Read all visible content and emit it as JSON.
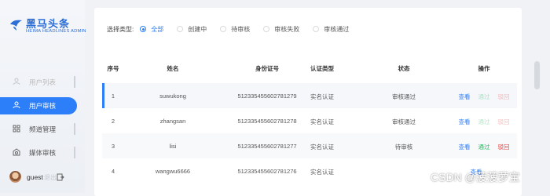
{
  "brand": {
    "name": "黑马头条",
    "sub": "HEIMA HEADLINES ADMIN"
  },
  "nav": [
    {
      "label": "用户列表",
      "icon": "user-list-icon",
      "state": "faded"
    },
    {
      "label": "用户审核",
      "icon": "user-audit-icon",
      "state": "active"
    },
    {
      "label": "频道管理",
      "icon": "channel-icon",
      "state": "normal"
    },
    {
      "label": "媒体审核",
      "icon": "media-icon",
      "state": "normal"
    }
  ],
  "user": {
    "name": "guest",
    "extra": "退出"
  },
  "filter": {
    "label": "选择类型:",
    "options": [
      "全部",
      "创建中",
      "待审核",
      "审核失败",
      "审核通过"
    ],
    "selected": "全部"
  },
  "table": {
    "headers": {
      "id": "序号",
      "name": "姓名",
      "idno": "身份证号",
      "type": "认证类型",
      "status": "状态",
      "ops": "操作"
    },
    "rows": [
      {
        "id": "1",
        "name": "suwukong",
        "idno": "512335455602781279",
        "type": "实名认证",
        "status": "审核通过",
        "view": "查看",
        "pass": "通过",
        "reject": "驳回"
      },
      {
        "id": "2",
        "name": "zhangsan",
        "idno": "512335455602781278",
        "type": "实名认证",
        "status": "审核通过",
        "view": "查看",
        "pass": "通过",
        "reject": "驳回"
      },
      {
        "id": "3",
        "name": "lisi",
        "idno": "512335455602781277",
        "type": "实名认证",
        "status": "待审核",
        "view": "查看",
        "pass": "通过",
        "reject": "驳回"
      },
      {
        "id": "4",
        "name": "wangwu6666",
        "idno": "512335455602781276",
        "type": "实名认证",
        "status": "",
        "view": "查看",
        "pass": "",
        "reject": ""
      }
    ]
  },
  "watermark": "CSDN @菠菠萝宝",
  "colors": {
    "accent": "#2d7ff9",
    "pass": "#1fbf5f",
    "reject": "#e64545"
  }
}
